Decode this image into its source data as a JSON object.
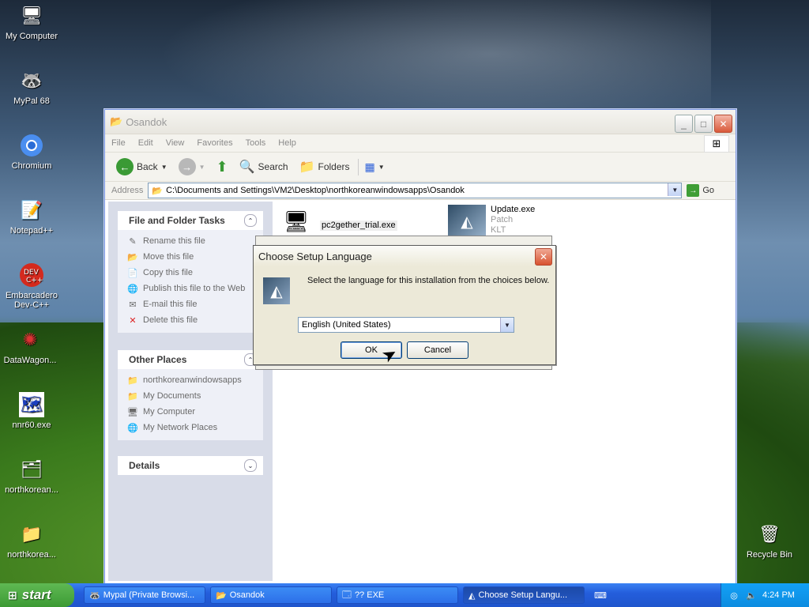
{
  "desktop": {
    "icons": [
      {
        "label": "My Computer",
        "icon": "computer-icon"
      },
      {
        "label": "MyPal 68",
        "icon": "mypal-icon"
      },
      {
        "label": "Chromium",
        "icon": "chromium-icon"
      },
      {
        "label": "Notepad++",
        "icon": "notepad-icon"
      },
      {
        "label": "Embarcadero Dev-C++",
        "icon": "devcpp-icon"
      },
      {
        "label": "DataWagon...",
        "icon": "datawagon-icon"
      },
      {
        "label": "nnr60.exe",
        "icon": "korea-map-icon"
      },
      {
        "label": "northkorean...",
        "icon": "zip-folder-icon"
      },
      {
        "label": "northkorea...",
        "icon": "folder-icon"
      },
      {
        "label": "Recycle Bin",
        "icon": "recycle-bin-icon"
      }
    ]
  },
  "explorer": {
    "title": "Osandok",
    "menu": [
      "File",
      "Edit",
      "View",
      "Favorites",
      "Tools",
      "Help"
    ],
    "toolbar": {
      "back": "Back",
      "search": "Search",
      "folders": "Folders"
    },
    "address_label": "Address",
    "address": "C:\\Documents and Settings\\VM2\\Desktop\\northkoreanwindowsapps\\Osandok",
    "go": "Go",
    "tasks_panel": {
      "title": "File and Folder Tasks",
      "items": [
        "Rename this file",
        "Move this file",
        "Copy this file",
        "Publish this file to the Web",
        "E-mail this file",
        "Delete this file"
      ]
    },
    "places_panel": {
      "title": "Other Places",
      "items": [
        "northkoreanwindowsapps",
        "My Documents",
        "My Computer",
        "My Network Places"
      ]
    },
    "details_panel": {
      "title": "Details"
    },
    "files": [
      {
        "name": "pc2gether_trial.exe",
        "sub1": "",
        "sub2": ""
      },
      {
        "name": "Update.exe",
        "sub1": "Patch",
        "sub2": "KLT"
      }
    ]
  },
  "dialog": {
    "title": "Choose Setup Language",
    "message": "Select the language for this installation from the choices below.",
    "selected_language": "English (United States)",
    "ok": "OK",
    "cancel": "Cancel"
  },
  "taskbar": {
    "start": "start",
    "tasks": [
      {
        "label": "Mypal (Private Browsi..."
      },
      {
        "label": "Osandok"
      },
      {
        "label": "?? EXE"
      },
      {
        "label": "Choose Setup Langu..."
      }
    ],
    "clock": "4:24 PM"
  },
  "colors": {
    "xp_blue": "#245edc",
    "start_green": "#3c9a34",
    "dialog_bg": "#ece9d8"
  }
}
